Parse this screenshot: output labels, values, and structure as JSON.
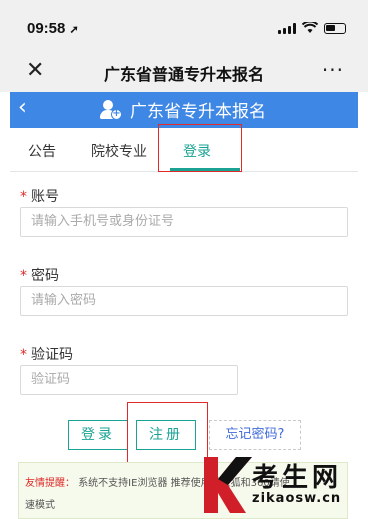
{
  "status": {
    "time": "09:58",
    "location_icon": "location-arrow-icon"
  },
  "window": {
    "title": "广东省普通专升本报名",
    "more_label": "···"
  },
  "header": {
    "title": "广东省专升本报名"
  },
  "tabs": [
    {
      "label": "公告",
      "active": false
    },
    {
      "label": "院校专业",
      "active": false
    },
    {
      "label": "登录",
      "active": true
    }
  ],
  "form": {
    "account": {
      "label": "账号",
      "placeholder": "请输入手机号或身份证号"
    },
    "password": {
      "label": "密码",
      "placeholder": "请输入密码"
    },
    "captcha": {
      "label": "验证码",
      "placeholder": "验证码"
    },
    "required_mark": "*"
  },
  "buttons": {
    "login": "登录",
    "register": "注册",
    "forgot": "忘记密码?"
  },
  "notice": {
    "title": "友情提醒：",
    "text": "系统不支持IE浏览器 推荐使用",
    "text_tail": "或火狐",
    "text_mid": "和360",
    "text_end": "请使",
    "line2": "速模式"
  },
  "watermark": {
    "brand": "考生网",
    "url": "zikaosw.cn"
  },
  "colors": {
    "accent": "#1aa394",
    "header_blue": "#3f87e5",
    "highlight_red": "#e02a2a"
  }
}
